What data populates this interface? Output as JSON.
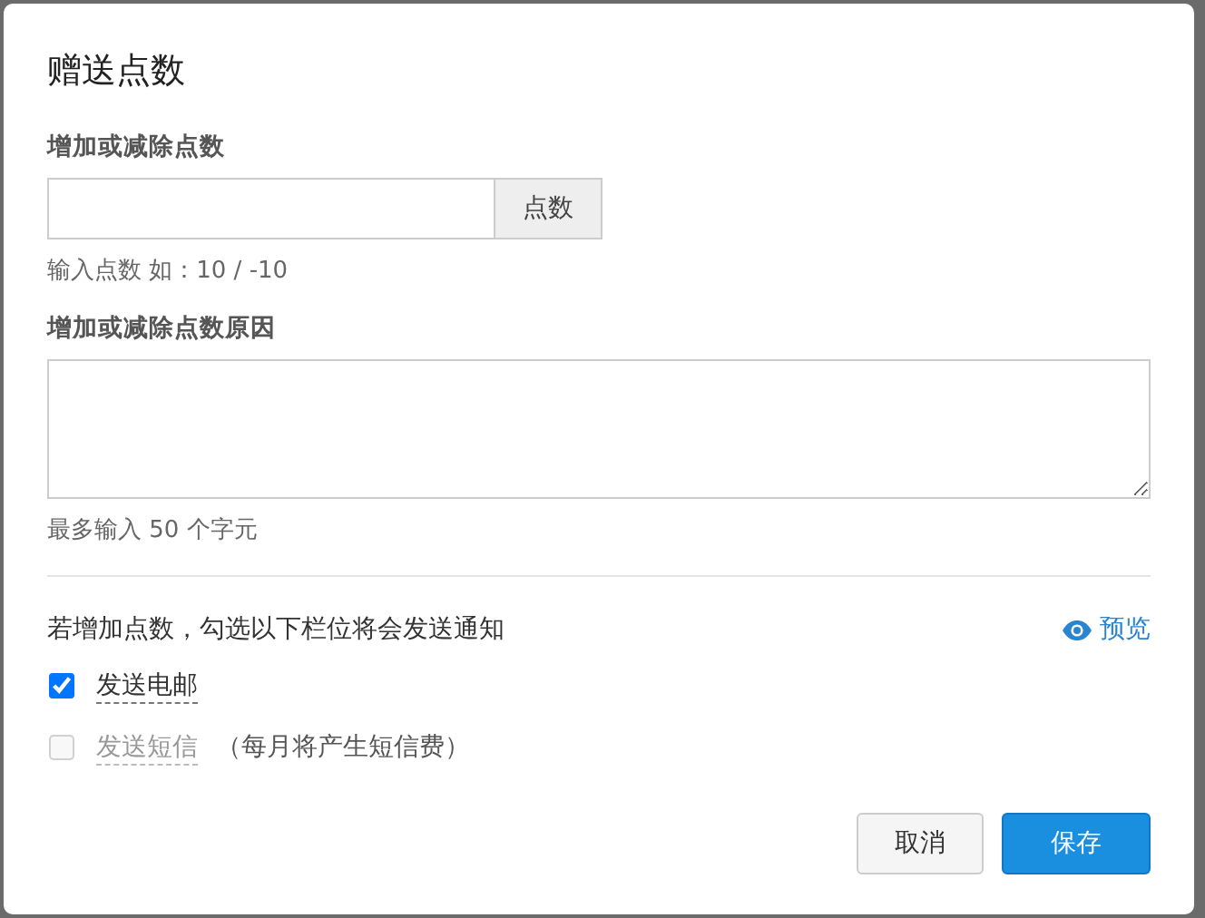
{
  "dialog": {
    "title": "赠送点数"
  },
  "points": {
    "label": "增加或减除点数",
    "addon": "点数",
    "hint": "输入点数 如：10 / -10"
  },
  "reason": {
    "label": "增加或减除点数原因",
    "hint": "最多输入 50 个字元"
  },
  "notify": {
    "text": "若增加点数，勾选以下栏位将会发送通知",
    "preview": "预览"
  },
  "options": [
    {
      "label": "发送电邮",
      "checked": true,
      "disabled": false
    },
    {
      "label": "发送短信",
      "note": "（每月将产生短信费）",
      "checked": false,
      "disabled": true
    }
  ],
  "buttons": [
    {
      "label": "取消",
      "kind": "secondary"
    },
    {
      "label": "保存",
      "kind": "primary"
    }
  ]
}
